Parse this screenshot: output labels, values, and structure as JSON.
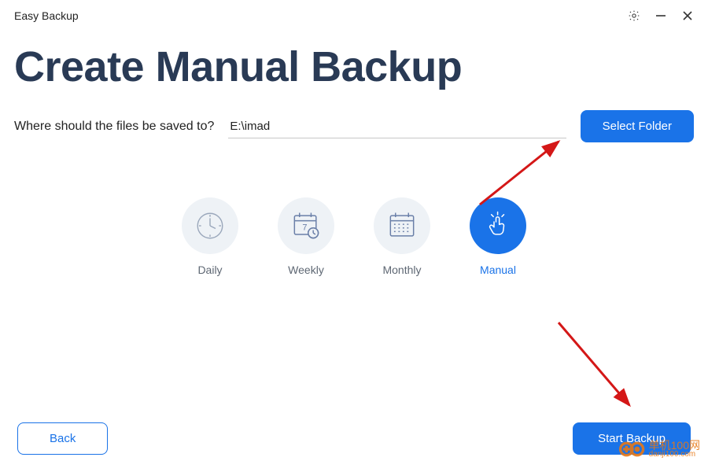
{
  "app": {
    "title": "Easy Backup"
  },
  "page": {
    "heading": "Create Manual Backup",
    "path_label": "Where should the files be saved to?",
    "path_value": "E:\\imad",
    "select_folder_label": "Select Folder"
  },
  "frequency": {
    "options": [
      {
        "key": "daily",
        "label": "Daily",
        "selected": false
      },
      {
        "key": "weekly",
        "label": "Weekly",
        "selected": false
      },
      {
        "key": "monthly",
        "label": "Monthly",
        "selected": false
      },
      {
        "key": "manual",
        "label": "Manual",
        "selected": true
      }
    ]
  },
  "footer": {
    "back_label": "Back",
    "start_label": "Start Backup"
  },
  "watermark": {
    "line1": "单机100网",
    "line2": "danji100.com"
  },
  "colors": {
    "primary": "#1a73e8",
    "heading": "#293a55",
    "circle_bg": "#eef2f6",
    "annotation": "#d41717",
    "watermark": "#e67817"
  }
}
